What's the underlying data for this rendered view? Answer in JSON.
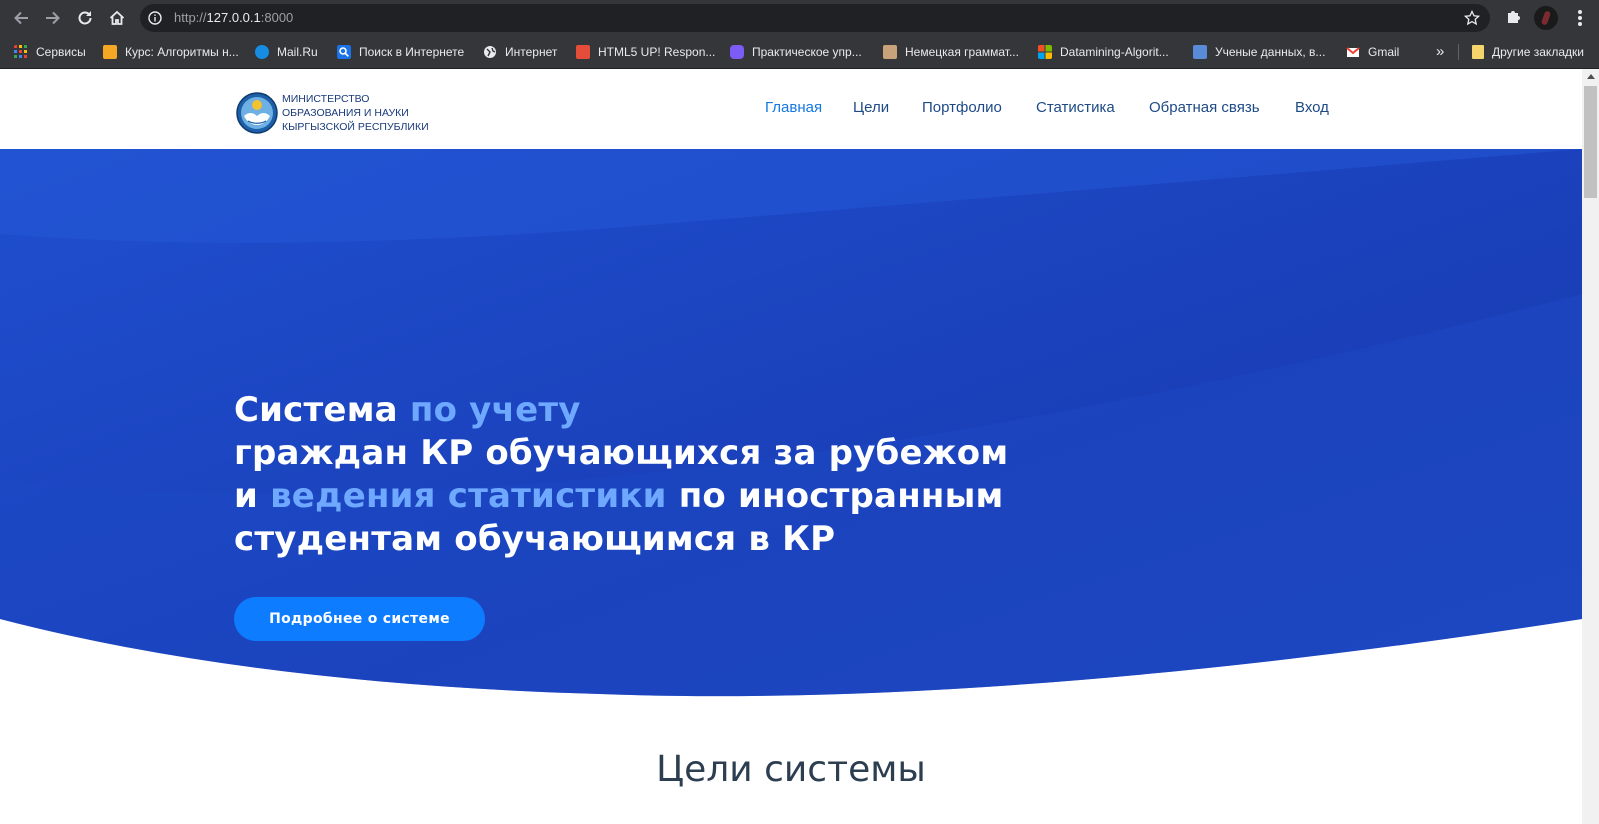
{
  "browser": {
    "url_scheme": "http://",
    "url_host": "127.0.0.1",
    "url_port": ":8000",
    "bookmarks": [
      {
        "label": "Сервисы",
        "icon": "apps-grid-icon",
        "color": "#ea4335"
      },
      {
        "label": "Курс: Алгоритмы н...",
        "icon": "course-icon",
        "color": "#f5a623"
      },
      {
        "label": "Mail.Ru",
        "icon": "mailru-icon",
        "color": "#168de2"
      },
      {
        "label": "Поиск в Интернете",
        "icon": "search-icon",
        "color": "#1a73e8"
      },
      {
        "label": "Интернет",
        "icon": "globe-icon",
        "color": "#e8eaed"
      },
      {
        "label": "HTML5 UP! Respon...",
        "icon": "html5up-icon",
        "color": "#e44d3a"
      },
      {
        "label": "Практическое упр...",
        "icon": "practice-icon",
        "color": "#7b5cf5"
      },
      {
        "label": "Немецкая граммат...",
        "icon": "grammar-icon",
        "color": "#c8a27a"
      },
      {
        "label": "Datamining-Algorit...",
        "icon": "microsoft-icon",
        "color": "#f25022"
      },
      {
        "label": "Ученые данных, в...",
        "icon": "data-scientists-icon",
        "color": "#5a8bd8"
      },
      {
        "label": "Gmail",
        "icon": "gmail-icon",
        "color": "#ea4335"
      }
    ],
    "more_label": "»",
    "other_bookmarks": "Другие закладки"
  },
  "site": {
    "logo_line1": "МИНИСТЕРСТВО",
    "logo_line2": "ОБРАЗОВАНИЯ И НАУКИ",
    "logo_line3": "КЫРГЫЗСКОЙ РЕСПУБЛИКИ",
    "nav": [
      {
        "label": "Главная",
        "active": true
      },
      {
        "label": "Цели",
        "active": false
      },
      {
        "label": "Портфолио",
        "active": false
      },
      {
        "label": "Статистика",
        "active": false
      },
      {
        "label": "Обратная связь",
        "active": false
      },
      {
        "label": "Вход",
        "active": false
      }
    ]
  },
  "hero": {
    "line1_a": "Система ",
    "line1_b": "по учету",
    "line2": "граждан КР обучающихся за рубежом",
    "line3_a": "и ",
    "line3_b": "ведения статистики",
    "line3_c": " по иностранным",
    "line4": "студентам обучающимся в КР",
    "cta": "Подробнее о системе"
  },
  "section": {
    "title": "Цели системы"
  },
  "colors": {
    "hero_dark": "#1a3fb8",
    "hero_light": "#2458d6",
    "accent": "#6ea8ff",
    "cta": "#0d7cff",
    "nav_active": "#1478e3"
  }
}
